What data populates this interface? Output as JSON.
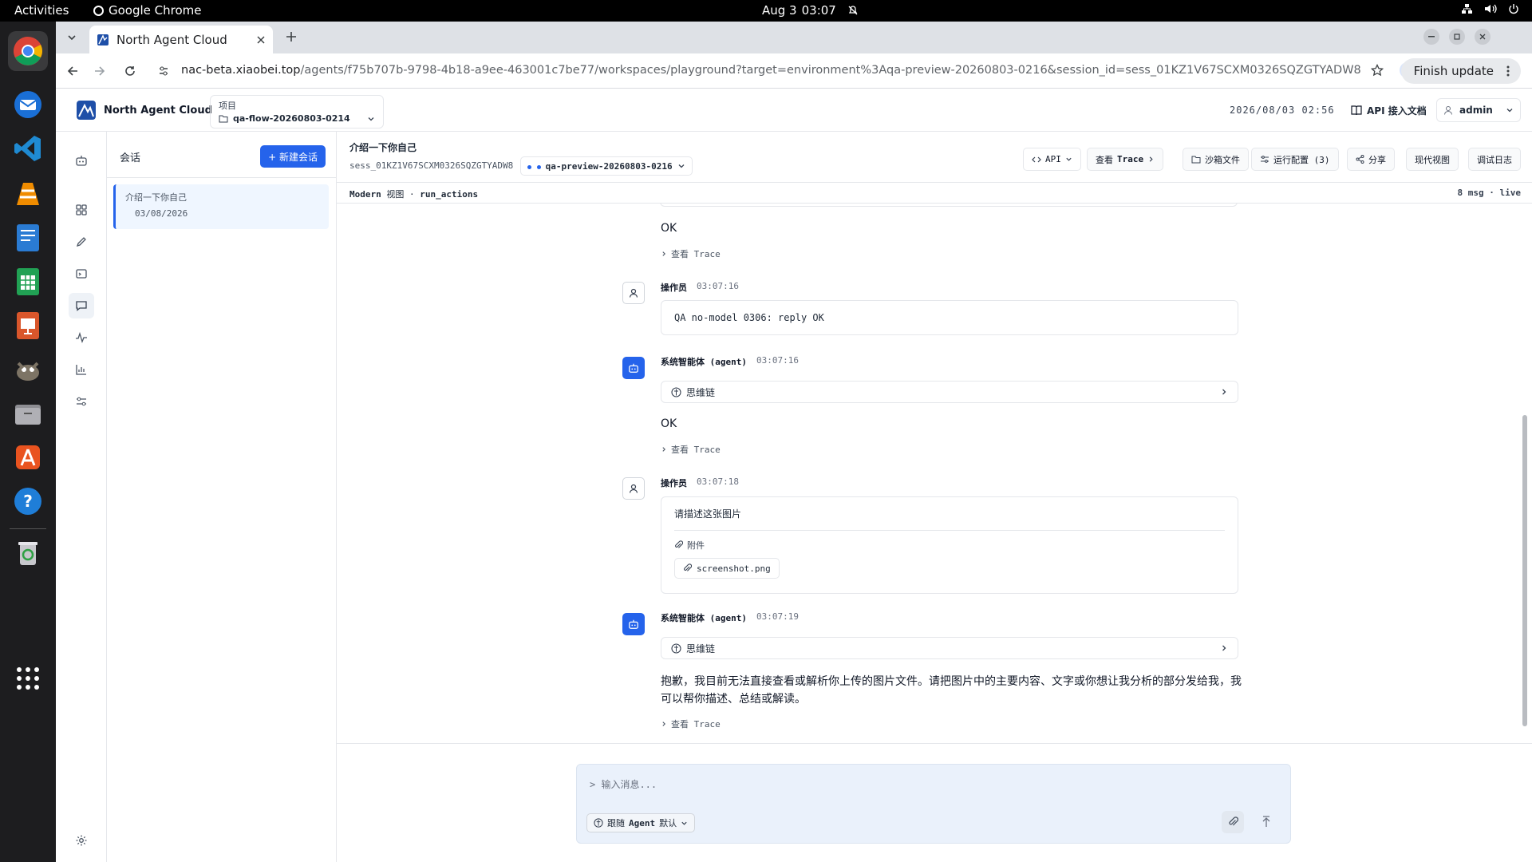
{
  "os": {
    "activities": "Activities",
    "app_name": "Google Chrome",
    "date": "Aug 3",
    "time": "03:07"
  },
  "browser": {
    "tab_title": "North Agent Cloud",
    "url_host": "nac-beta.xiaobei.top",
    "url_path": "/agents/f75b707b-9798-4b18-a9ee-463001c7be77/workspaces/playground?target=environment%3Aqa-preview-20260803-0216&session_id=sess_01KZ1V67SCXM0326SQZGTYADW8",
    "finish_update": "Finish update"
  },
  "header": {
    "brand": "North Agent Cloud",
    "project_label": "项目",
    "project_value": "qa-flow-20260803-0214",
    "datetime": "2026/08/03 02:56",
    "api_docs": "API 接入文档",
    "user": "admin"
  },
  "sessions": {
    "title": "会话",
    "new_button": "+ 新建会话",
    "items": [
      {
        "title": "介绍一下你自己",
        "date": "03/08/2026"
      }
    ]
  },
  "chat": {
    "title": "介绍一下你自己",
    "session_id": "sess_01KZ1V67SCXM0326SQZGTYADW8",
    "environment": "qa-preview-20260803-0216",
    "toolbar": {
      "api": "API",
      "view_trace_prefix": "查看",
      "view_trace_bold": "Trace",
      "sandbox_files": "沙箱文件",
      "run_config": "运行配置 (3)",
      "share": "分享",
      "modern_view": "现代视图",
      "debug_log": "调试日志"
    },
    "subbar": {
      "mode": "Modern",
      "view": "视图",
      "sep": "·",
      "action": "run_actions",
      "stats": "8 msg · live"
    },
    "view_trace": "查看 Trace",
    "think_chain": "思维链",
    "attachment_label": "附件",
    "messages": [
      {
        "role": "agent-reply",
        "text": "OK"
      },
      {
        "role": "user",
        "who": "操作员",
        "time": "03:07:16",
        "text": "QA no-model 0306: reply OK"
      },
      {
        "role": "agent",
        "who": "系统智能体 (agent)",
        "time": "03:07:16",
        "text": "OK"
      },
      {
        "role": "user",
        "who": "操作员",
        "time": "03:07:18",
        "text": "请描述这张图片",
        "attachment": "screenshot.png"
      },
      {
        "role": "agent",
        "who": "系统智能体 (agent)",
        "time": "03:07:19",
        "text": "抱歉，我目前无法直接查看或解析你上传的图片文件。请把图片中的主要内容、文字或你想让我分析的部分发给我，我可以帮你描述、总结或解读。"
      }
    ]
  },
  "composer": {
    "placeholder": "> 输入消息...",
    "agent_select_prefix": "跟随",
    "agent_select_bold": "Agent",
    "agent_select_suffix": "默认"
  },
  "colors": {
    "accent": "#2563eb",
    "composer_bg": "#eaf1fb"
  }
}
